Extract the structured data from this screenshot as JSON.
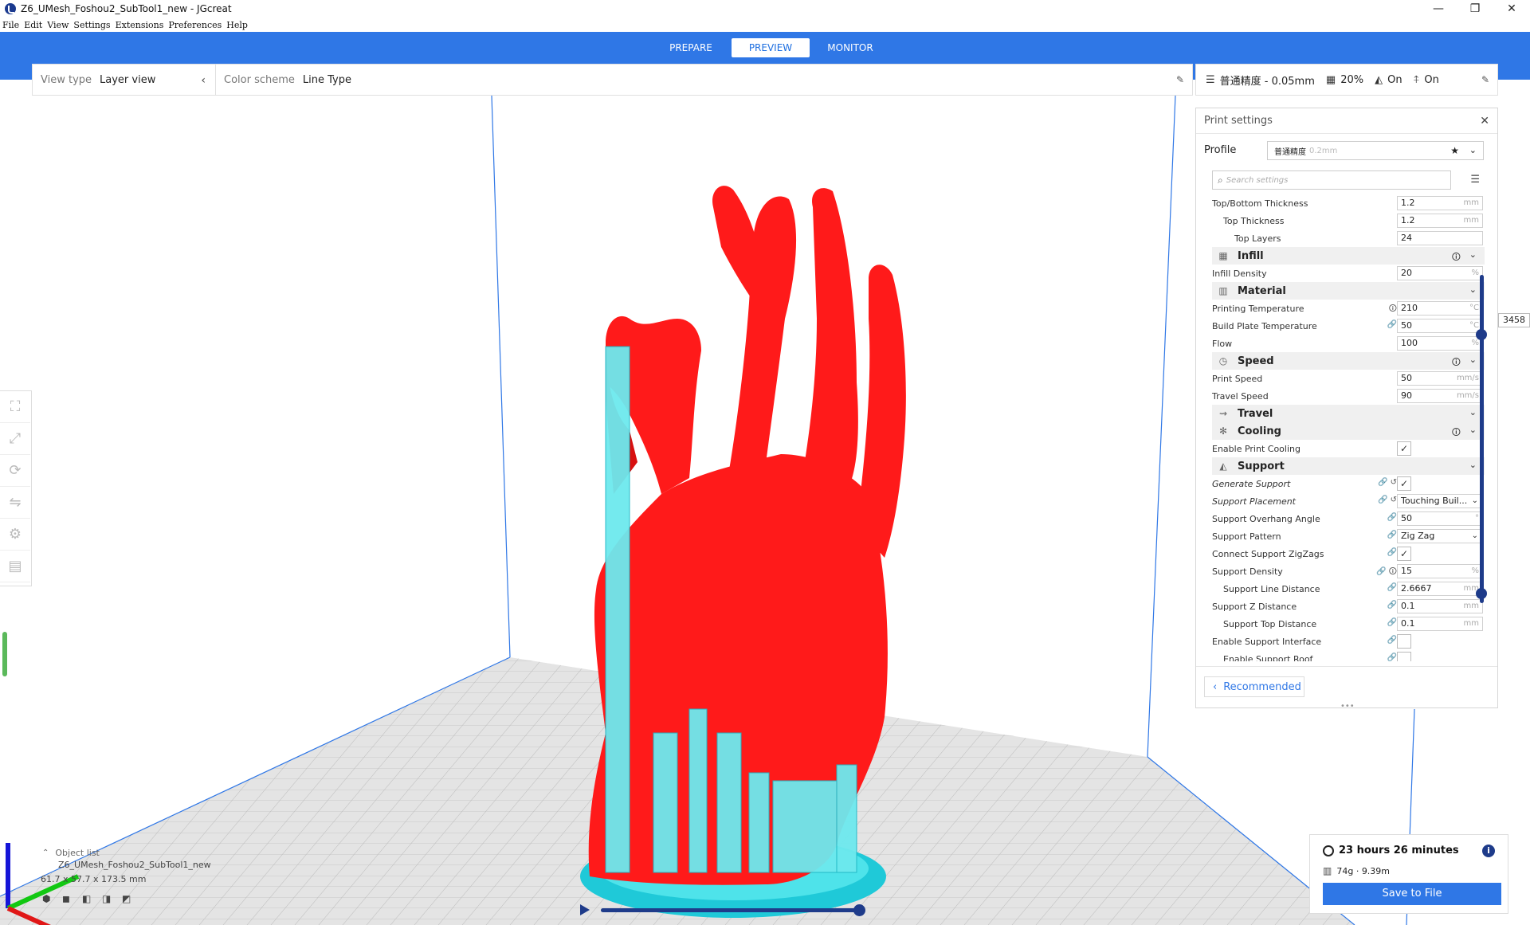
{
  "window": {
    "title": "Z6_UMesh_Foshou2_SubTool1_new - JGcreat",
    "minimize": "—",
    "maximize": "❐",
    "close": "✕"
  },
  "menu": [
    "File",
    "Edit",
    "View",
    "Settings",
    "Extensions",
    "Preferences",
    "Help"
  ],
  "stages": [
    {
      "label": "PREPARE",
      "active": false
    },
    {
      "label": "PREVIEW",
      "active": true
    },
    {
      "label": "MONITOR",
      "active": false
    }
  ],
  "view_bar": {
    "view_type_label": "View type",
    "view_type_value": "Layer view",
    "color_scheme_label": "Color scheme",
    "color_scheme_value": "Line Type"
  },
  "settings_bar": {
    "profile": "普通精度 - 0.05mm",
    "infill": "20%",
    "support": "On",
    "adhesion": "On"
  },
  "panel": {
    "title": "Print settings",
    "profile_label": "Profile",
    "profile_value": "普通精度",
    "profile_sub": "0.2mm",
    "search_placeholder": "Search settings",
    "recommended_label": "Recommended"
  },
  "settings": [
    {
      "type": "row",
      "name": "Top/Bottom Thickness",
      "value": "1.2",
      "unit": "mm",
      "indent": 0
    },
    {
      "type": "row",
      "name": "Top Thickness",
      "value": "1.2",
      "unit": "mm",
      "indent": 1
    },
    {
      "type": "row",
      "name": "Top Layers",
      "value": "24",
      "unit": "",
      "indent": 2
    },
    {
      "type": "header",
      "name": "Infill",
      "icon": "infill-icon",
      "glyph": "▦",
      "info": true
    },
    {
      "type": "row",
      "name": "Infill Density",
      "value": "20",
      "unit": "%",
      "indent": 0
    },
    {
      "type": "header",
      "name": "Material",
      "icon": "material-icon",
      "glyph": "▥",
      "info": false
    },
    {
      "type": "row",
      "name": "Printing Temperature",
      "value": "210",
      "unit": "°C",
      "indent": 0,
      "icons": "🛈"
    },
    {
      "type": "row",
      "name": "Build Plate Temperature",
      "value": "50",
      "unit": "°C",
      "indent": 0,
      "icons": "🔗"
    },
    {
      "type": "row",
      "name": "Flow",
      "value": "100",
      "unit": "%",
      "indent": 0
    },
    {
      "type": "header",
      "name": "Speed",
      "icon": "speed-icon",
      "glyph": "◷",
      "info": true
    },
    {
      "type": "row",
      "name": "Print Speed",
      "value": "50",
      "unit": "mm/s",
      "indent": 0
    },
    {
      "type": "row",
      "name": "Travel Speed",
      "value": "90",
      "unit": "mm/s",
      "indent": 0
    },
    {
      "type": "header",
      "name": "Travel",
      "icon": "travel-icon",
      "glyph": "⇝",
      "info": false
    },
    {
      "type": "header",
      "name": "Cooling",
      "icon": "cooling-icon",
      "glyph": "✻",
      "info": true
    },
    {
      "type": "check",
      "name": "Enable Print Cooling",
      "checked": true,
      "indent": 0
    },
    {
      "type": "header",
      "name": "Support",
      "icon": "support-icon",
      "glyph": "◭",
      "info": false
    },
    {
      "type": "check",
      "name": "Generate Support",
      "checked": true,
      "indent": 0,
      "italic": true,
      "icons": "🔗 ↺"
    },
    {
      "type": "select",
      "name": "Support Placement",
      "value": "Touching Buil...",
      "indent": 0,
      "italic": true,
      "icons": "🔗 ↺"
    },
    {
      "type": "row",
      "name": "Support Overhang Angle",
      "value": "50",
      "unit": "°",
      "indent": 0,
      "icons": "🔗"
    },
    {
      "type": "select",
      "name": "Support Pattern",
      "value": "Zig Zag",
      "indent": 0,
      "icons": "🔗"
    },
    {
      "type": "check",
      "name": "Connect Support ZigZags",
      "checked": true,
      "indent": 0,
      "icons": "🔗"
    },
    {
      "type": "row",
      "name": "Support Density",
      "value": "15",
      "unit": "%",
      "indent": 0,
      "icons": "🔗 🛈"
    },
    {
      "type": "row",
      "name": "Support Line Distance",
      "value": "2.6667",
      "unit": "mm",
      "indent": 1,
      "icons": "🔗"
    },
    {
      "type": "row",
      "name": "Support Z Distance",
      "value": "0.1",
      "unit": "mm",
      "indent": 0,
      "icons": "🔗"
    },
    {
      "type": "row",
      "name": "Support Top Distance",
      "value": "0.1",
      "unit": "mm",
      "indent": 1,
      "icons": "🔗"
    },
    {
      "type": "check",
      "name": "Enable Support Interface",
      "checked": false,
      "indent": 0,
      "icons": "🔗"
    },
    {
      "type": "check",
      "name": "Enable Support Roof",
      "checked": false,
      "indent": 1,
      "icons": "🔗"
    }
  ],
  "layer_slider": {
    "value": "3458"
  },
  "object_list": {
    "label": "Object list",
    "item": "Z6_UMesh_Foshou2_SubTool1_new",
    "dimensions": "61.7 x 57.7 x 173.5 mm"
  },
  "output": {
    "time": "23 hours 26 minutes",
    "material": "74g · 9.39m",
    "save_label": "Save to File"
  },
  "colors": {
    "accent": "#2f77e6",
    "model": "#ff1a1a",
    "support": "#3fe0e6",
    "slider": "#1e3b8a"
  }
}
